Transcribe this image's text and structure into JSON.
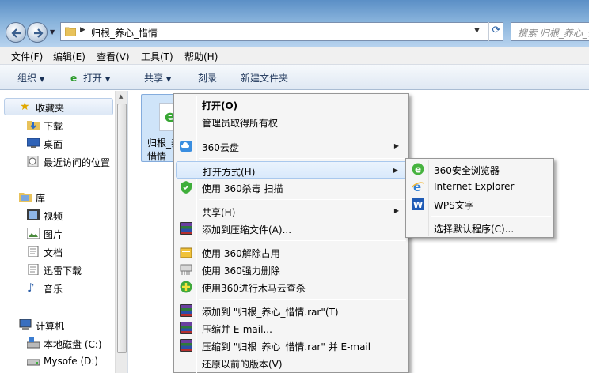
{
  "address": {
    "path": "归根_养心_惜情"
  },
  "search": {
    "placeholder": "搜索 归根_养心_惜..."
  },
  "menubar": {
    "items": [
      "文件(F)",
      "编辑(E)",
      "查看(V)",
      "工具(T)",
      "帮助(H)"
    ]
  },
  "toolbar": {
    "organize": "组织",
    "open": "打开",
    "share": "共享",
    "burn": "刻录",
    "new_folder": "新建文件夹"
  },
  "navpane": {
    "favorites": "收藏夹",
    "fav_items": [
      "下载",
      "桌面",
      "最近访问的位置"
    ],
    "libraries": "库",
    "lib_items": [
      "视频",
      "图片",
      "文档",
      "迅雷下载",
      "音乐"
    ],
    "computer": "计算机",
    "drives": [
      "本地磁盘 (C:)",
      "Mysofe (D:)"
    ]
  },
  "file": {
    "name": "归根_养心_惜情"
  },
  "context_menu": {
    "items": [
      "打开(O)",
      "管理员取得所有权",
      "360云盘",
      "打开方式(H)",
      "使用 360杀毒 扫描",
      "共享(H)",
      "添加到压缩文件(A)...",
      "使用 360解除占用",
      "使用 360强力删除",
      "使用360进行木马云查杀",
      "添加到 \"归根_养心_惜情.rar\"(T)",
      "压缩并 E-mail...",
      "压缩到 \"归根_养心_惜情.rar\" 并 E-mail",
      "还原以前的版本(V)"
    ]
  },
  "open_with_menu": {
    "items": [
      "360安全浏览器",
      "Internet Explorer",
      "WPS文字",
      "选择默认程序(C)..."
    ]
  }
}
